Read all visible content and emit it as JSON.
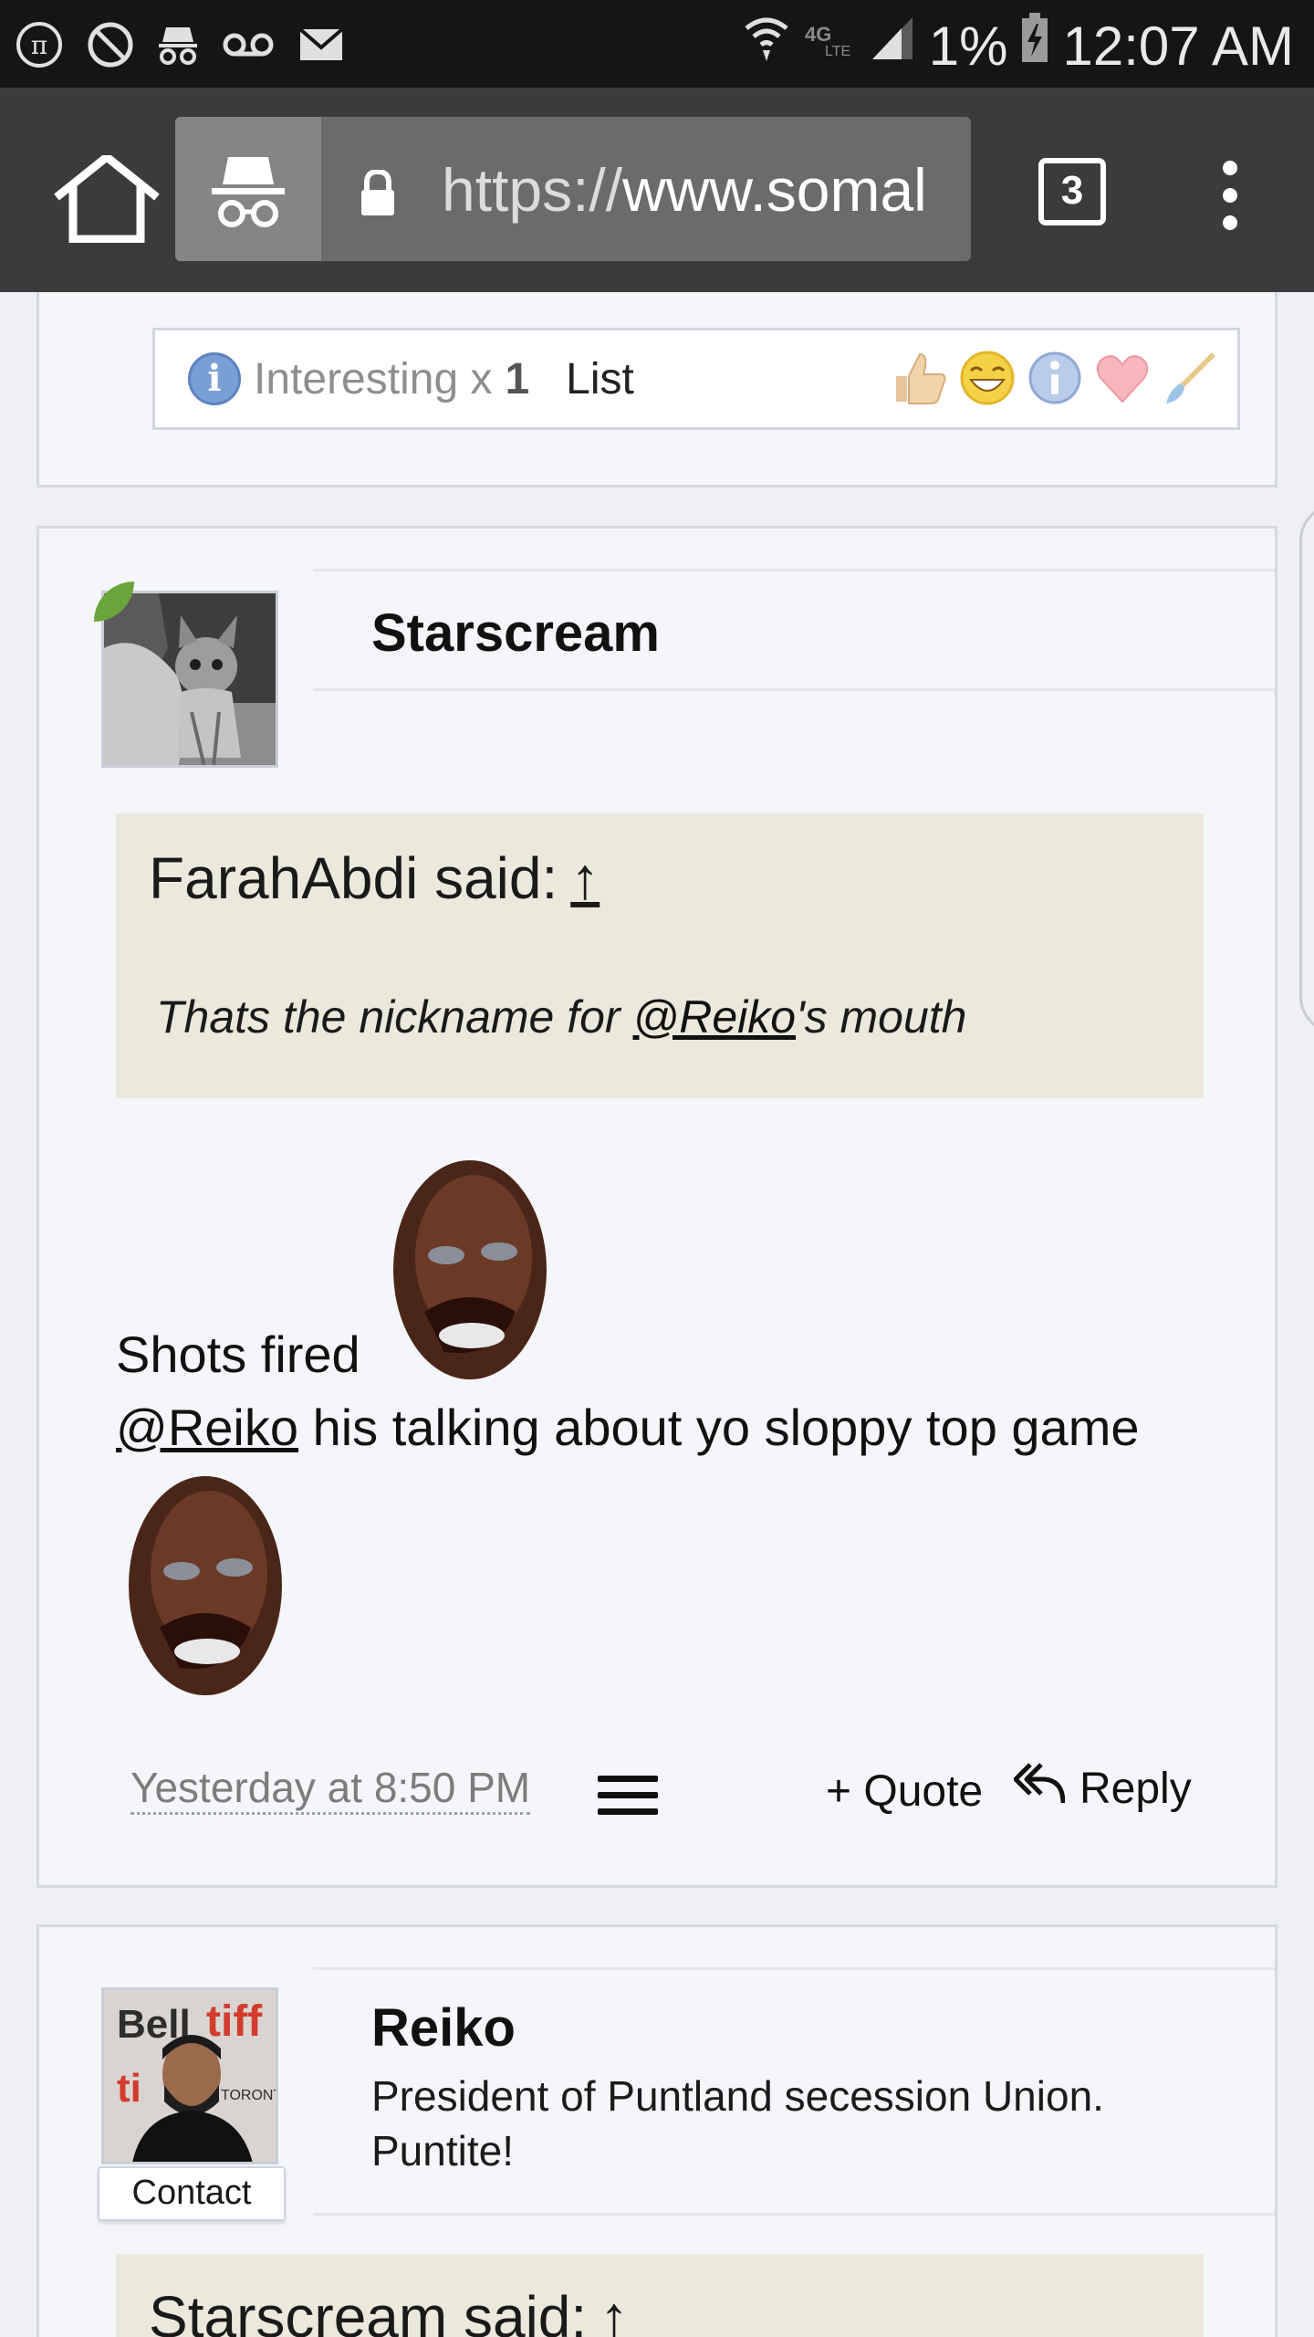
{
  "status_bar": {
    "battery": "1%",
    "time": "12:07 AM",
    "icons": [
      "pi-icon",
      "blocked-icon",
      "incognito-icon",
      "voicemail-icon",
      "mail-icon",
      "wifi-icon",
      "lte-icon",
      "signal-icon",
      "battery-icon"
    ]
  },
  "browser": {
    "url_scheme": "https://",
    "url_host": "www.somal",
    "tab_count": "3",
    "icons": [
      "home-icon",
      "incognito-icon",
      "lock-icon",
      "more-vert-icon"
    ]
  },
  "reaction_bar": {
    "label": "Interesting x",
    "count": "1",
    "list_link": "List",
    "reaction_icons": [
      "like-icon",
      "funny-icon",
      "info-icon",
      "love-icon",
      "brush-icon"
    ]
  },
  "post1": {
    "username": "Starscream",
    "quote_author": "FarahAbdi said:",
    "quote_jump": "↑",
    "quote_text_before": "Thats the nickname for ",
    "quote_mention": "@Reiko",
    "quote_text_after": "'s mouth",
    "line1": "Shots fired",
    "line2_mention": "@Reiko",
    "line2_text": " his talking about yo sloppy top game",
    "timestamp": "Yesterday at 8:50 PM",
    "quote_btn": "+ Quote",
    "reply_btn": "Reply"
  },
  "post2": {
    "username": "Reiko",
    "user_title": "President of Puntland secession Union. Puntite!",
    "contact_btn": "Contact",
    "quote_author": "Starscream said:",
    "quote_jump": "↑"
  }
}
